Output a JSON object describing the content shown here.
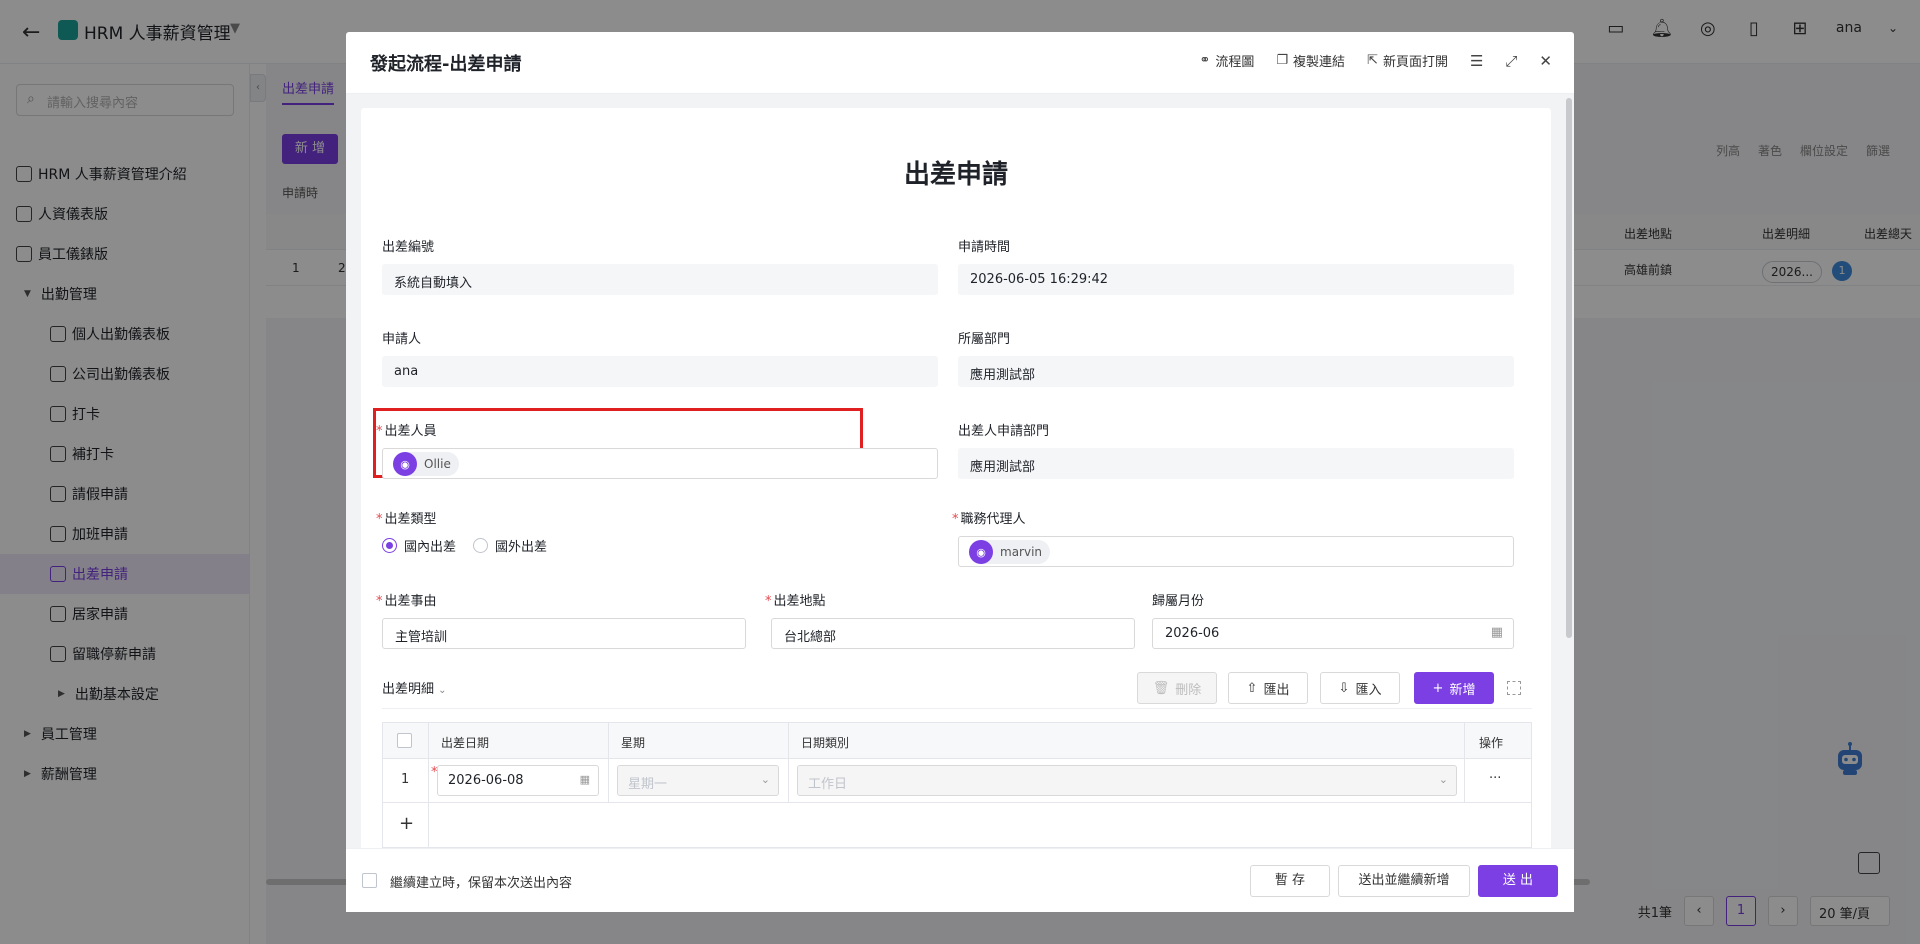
{
  "app": {
    "title": "HRM 人事薪資管理",
    "user": "ana"
  },
  "sidebar": {
    "search_placeholder": "請輸入搜尋內容",
    "items": [
      {
        "label": "HRM 人事薪資管理介紹"
      },
      {
        "label": "人資儀表版"
      },
      {
        "label": "員工儀錶版"
      },
      {
        "label": "出勤管理"
      },
      {
        "label": "個人出勤儀表板"
      },
      {
        "label": "公司出勤儀表板"
      },
      {
        "label": "打卡"
      },
      {
        "label": "補打卡"
      },
      {
        "label": "請假申請"
      },
      {
        "label": "加班申請"
      },
      {
        "label": "出差申請"
      },
      {
        "label": "居家申請"
      },
      {
        "label": "留職停薪申請"
      },
      {
        "label": "出勤基本設定"
      },
      {
        "label": "員工管理"
      },
      {
        "label": "薪酬管理"
      }
    ]
  },
  "background": {
    "tab": "出差申請",
    "add_button": "新 增",
    "tools": [
      "列高",
      "著色",
      "欄位設定",
      "篩選"
    ],
    "filter": "申請時",
    "columns": [
      "出差地點",
      "出差明細",
      "出差總天"
    ],
    "row": {
      "index": "1",
      "col2": "2",
      "location": "高雄前鎮",
      "detail": "2026...",
      "badge": "1"
    },
    "pager": {
      "total": "共1筆",
      "current": "1",
      "size": "20 筆/頁"
    }
  },
  "modal": {
    "title": "發起流程-出差申請",
    "actions": [
      "流程圖",
      "複製連結",
      "新頁面打開"
    ],
    "form_title": "出差申請",
    "fields": {
      "trip_no": {
        "label": "出差編號",
        "value": "系統自動填入"
      },
      "apply_time": {
        "label": "申請時間",
        "value": "2026-06-05 16:29:42"
      },
      "applicant": {
        "label": "申請人",
        "value": "ana"
      },
      "dept": {
        "label": "所屬部門",
        "value": "應用測試部"
      },
      "traveler": {
        "label": "出差人員",
        "value": "Ollie"
      },
      "traveler_dept": {
        "label": "出差人申請部門",
        "value": "應用測試部"
      },
      "trip_type": {
        "label": "出差類型",
        "options": [
          "國內出差",
          "國外出差"
        ],
        "selected": "國內出差"
      },
      "agent": {
        "label": "職務代理人",
        "value": "marvin"
      },
      "reason": {
        "label": "出差事由",
        "value": "主管培訓"
      },
      "location": {
        "label": "出差地點",
        "value": "台北總部"
      },
      "month": {
        "label": "歸屬月份",
        "value": "2026-06"
      }
    },
    "detail": {
      "title": "出差明細",
      "buttons": {
        "delete": "刪除",
        "export": "匯出",
        "import": "匯入",
        "add": "新增"
      },
      "columns": [
        "出差日期",
        "星期",
        "日期類別",
        "操作"
      ],
      "rows": [
        {
          "index": "1",
          "date": "2026-06-08",
          "weekday": "星期一",
          "day_type": "工作日",
          "ops": "···"
        }
      ],
      "add_row": "+"
    },
    "footer": {
      "keep_label": "繼續建立時，保留本次送出內容",
      "save": "暫 存",
      "submit_continue": "送出並繼續新增",
      "submit": "送 出"
    }
  },
  "colors": {
    "accent": "#7b3fe4",
    "highlight": "#e02020",
    "required": "#e5484d"
  }
}
